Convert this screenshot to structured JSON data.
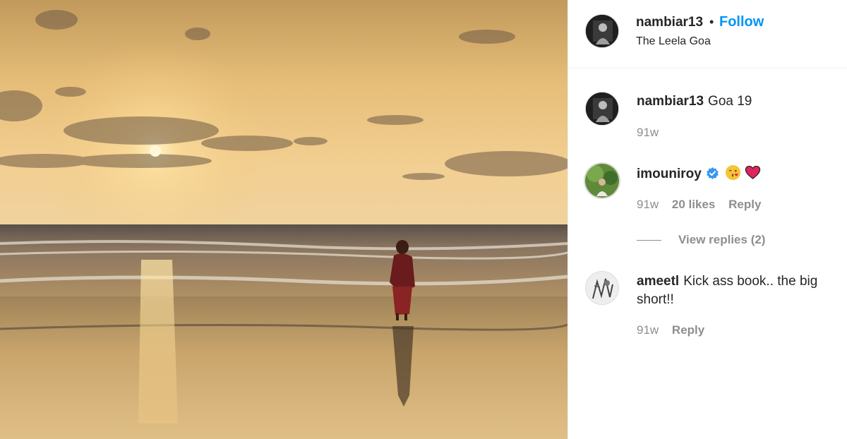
{
  "post": {
    "author": "nambiar13",
    "separator": "•",
    "follow_label": "Follow",
    "location": "The Leela Goa"
  },
  "comments": [
    {
      "username": "nambiar13",
      "text": "Goa 19",
      "time": "91w"
    },
    {
      "username": "imouniroy",
      "verified": true,
      "emojis": [
        "kissing-face-emoji",
        "red-heart-emoji"
      ],
      "time": "91w",
      "likes": "20 likes",
      "reply_label": "Reply",
      "view_replies": "View replies (2)"
    },
    {
      "username": "ameetl",
      "text": "Kick ass book.. the big short!!",
      "time": "91w",
      "reply_label": "Reply"
    }
  ],
  "colors": {
    "accent": "#0095f6",
    "muted": "#8e8e8e",
    "text": "#262626",
    "sky_top": "#c9a160",
    "sky_mid": "#f0c67e",
    "sun": "#fff4c8"
  }
}
